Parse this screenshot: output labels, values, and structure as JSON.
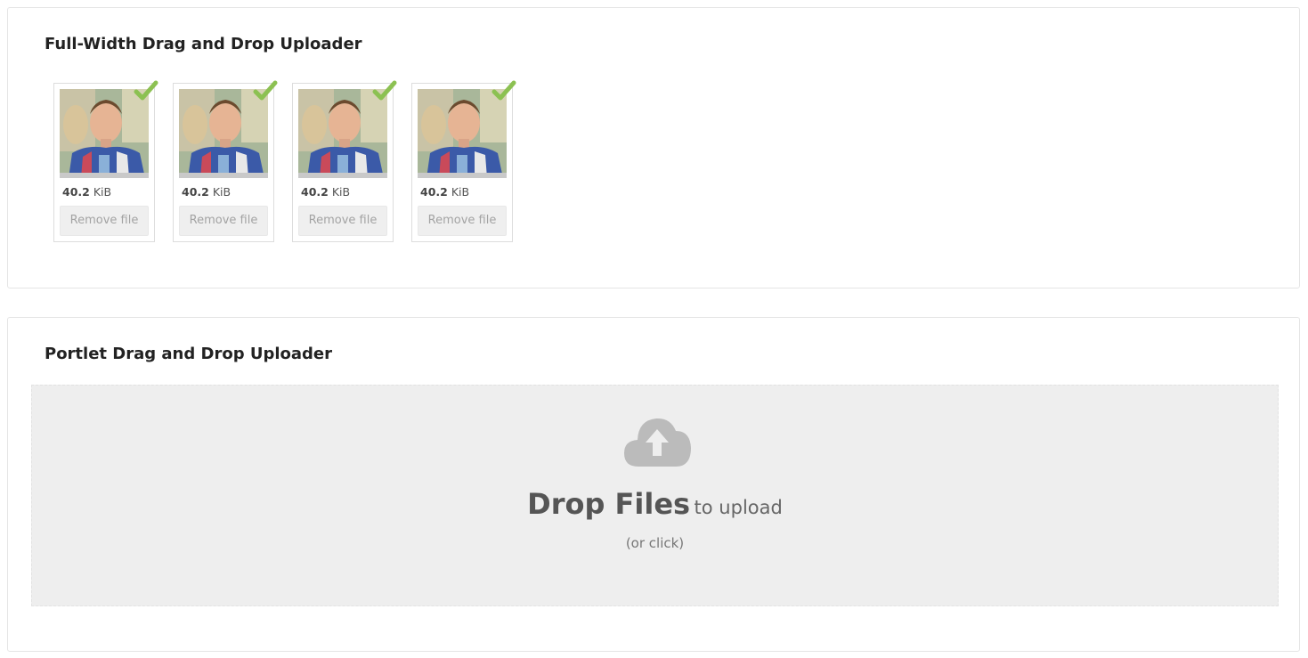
{
  "full_width_uploader": {
    "title": "Full-Width Drag and Drop Uploader",
    "files": [
      {
        "size_value": "40.2",
        "size_unit": "KiB",
        "remove_label": "Remove file",
        "status": "success"
      },
      {
        "size_value": "40.2",
        "size_unit": "KiB",
        "remove_label": "Remove file",
        "status": "success"
      },
      {
        "size_value": "40.2",
        "size_unit": "KiB",
        "remove_label": "Remove file",
        "status": "success"
      },
      {
        "size_value": "40.2",
        "size_unit": "KiB",
        "remove_label": "Remove file",
        "status": "success"
      }
    ]
  },
  "portlet_uploader": {
    "title": "Portlet Drag and Drop Uploader",
    "drop_main": "Drop Files",
    "drop_sub": "to upload",
    "drop_hint": "(or click)",
    "icon": "cloud-upload-icon"
  },
  "colors": {
    "success_check": "#8cc152",
    "dropzone_bg": "#eeeeee",
    "icon_gray": "#bbbbbb"
  }
}
